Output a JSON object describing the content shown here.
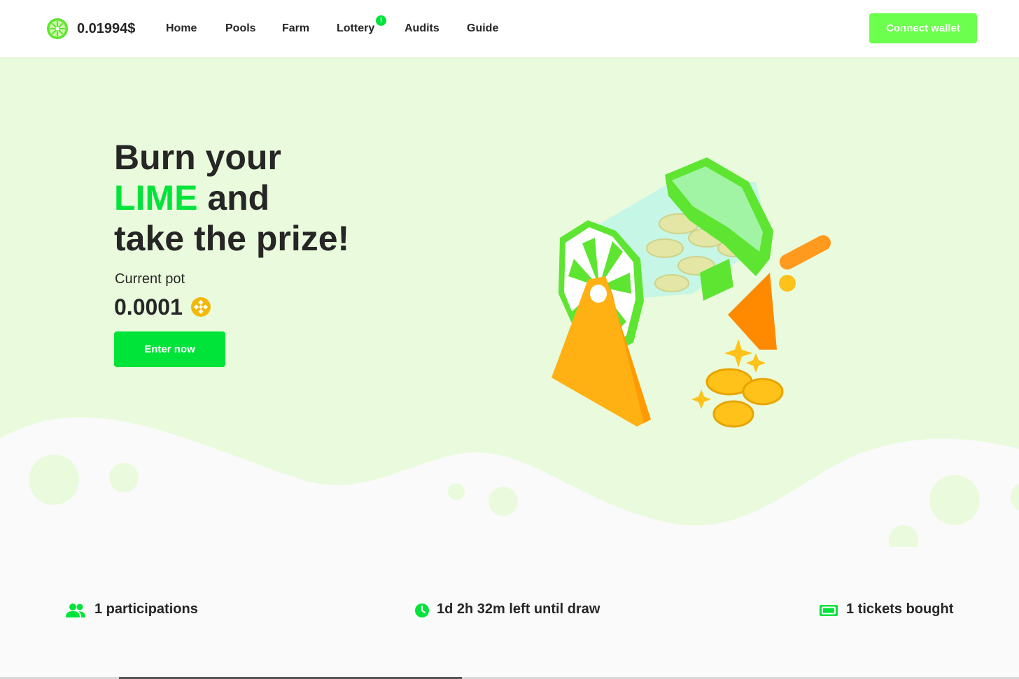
{
  "header": {
    "price": "0.01994$",
    "nav": [
      {
        "label": "Home"
      },
      {
        "label": "Pools"
      },
      {
        "label": "Farm"
      },
      {
        "label": "Lottery",
        "badge": "!"
      },
      {
        "label": "Audits"
      },
      {
        "label": "Guide"
      }
    ],
    "connect_label": "Connect wallet"
  },
  "hero": {
    "title_line1": "Burn your",
    "title_highlight": "LIME",
    "title_line2_rest": " and",
    "title_line3": "take the prize!",
    "pot_label": "Current pot",
    "pot_value": "0.0001",
    "pot_currency_icon": "bnb-icon",
    "enter_label": "Enter now"
  },
  "stats": {
    "participations": "1 participations",
    "time_left": "1d 2h 32m left until draw",
    "tickets": "1 tickets bought"
  },
  "colors": {
    "accent": "#00e43a",
    "button_light": "#6cff4e",
    "hero_bg": "#e9fbdc",
    "text": "#262626",
    "bnb": "#f0b90b"
  }
}
